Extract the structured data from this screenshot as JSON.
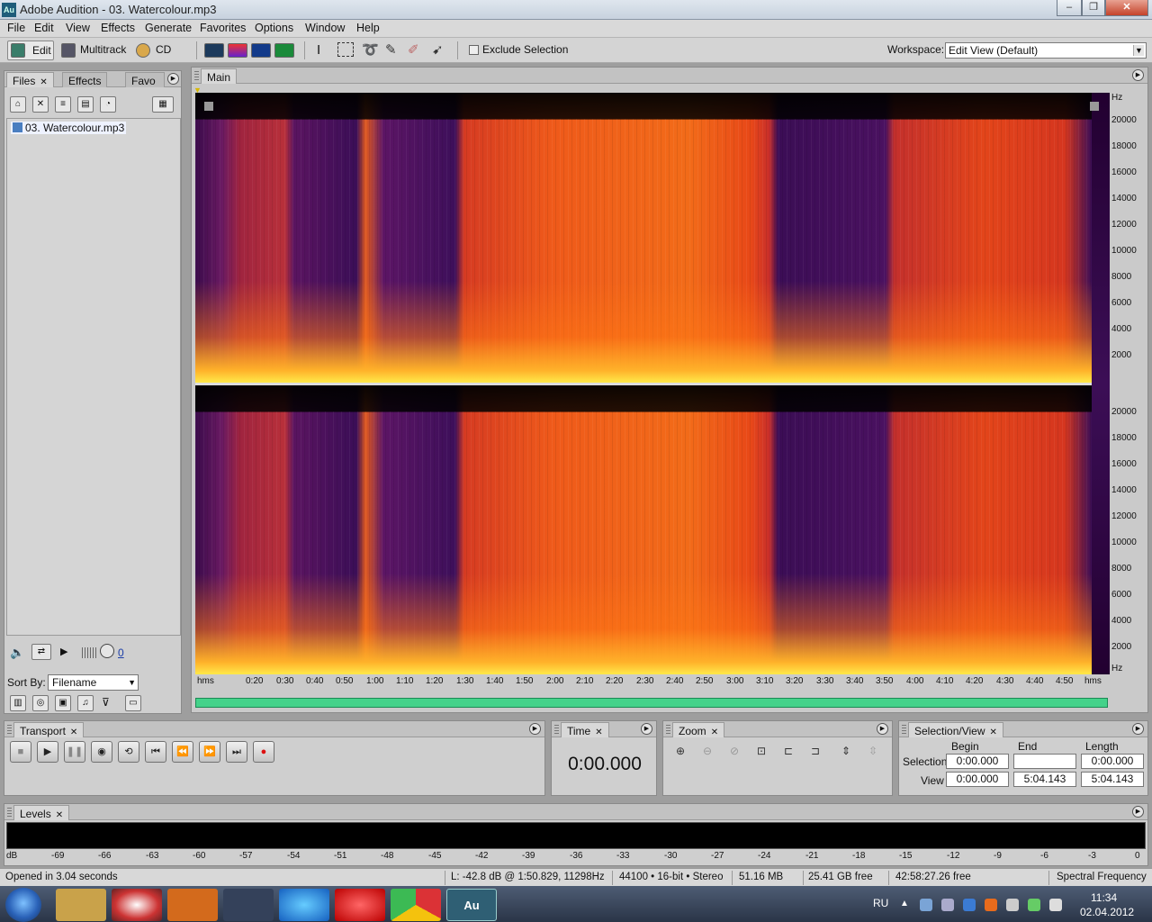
{
  "window": {
    "title": "Adobe Audition - 03. Watercolour.mp3",
    "app_icon": "Au",
    "min": "–",
    "max": "❐",
    "close": "✕"
  },
  "menu": [
    "File",
    "Edit",
    "View",
    "Effects",
    "Generate",
    "Favorites",
    "Options",
    "Window",
    "Help"
  ],
  "toolbar": {
    "edit_label": "Edit",
    "multitrack_label": "Multitrack",
    "cd_label": "CD",
    "exclude_selection": "Exclude Selection",
    "workspace_label": "Workspace:",
    "workspace_value": "Edit View (Default)"
  },
  "files_panel": {
    "tabs": [
      "Files",
      "Effects",
      "Favo"
    ],
    "file": "03. Watercolour.mp3",
    "sort_by_label": "Sort By:",
    "sort_by_value": "Filename",
    "volume_value": "0"
  },
  "main": {
    "tab": "Main",
    "hz_unit": "Hz",
    "hz_ticks_top": [
      "20000",
      "18000",
      "16000",
      "14000",
      "12000",
      "10000",
      "8000",
      "6000",
      "4000",
      "2000"
    ],
    "hz_ticks_bottom": [
      "20000",
      "18000",
      "16000",
      "14000",
      "12000",
      "10000",
      "8000",
      "6000",
      "4000",
      "2000",
      "Hz"
    ],
    "time_ticks": [
      "hms",
      "0:20",
      "0:30",
      "0:40",
      "0:50",
      "1:00",
      "1:10",
      "1:20",
      "1:30",
      "1:40",
      "1:50",
      "2:00",
      "2:10",
      "2:20",
      "2:30",
      "2:40",
      "2:50",
      "3:00",
      "3:10",
      "3:20",
      "3:30",
      "3:40",
      "3:50",
      "4:00",
      "4:10",
      "4:20",
      "4:30",
      "4:40",
      "4:50",
      "hms"
    ]
  },
  "transport": {
    "title": "Transport"
  },
  "time": {
    "title": "Time",
    "value": "0:00.000"
  },
  "zoom": {
    "title": "Zoom"
  },
  "selection_view": {
    "title": "Selection/View",
    "headers": [
      "Begin",
      "End",
      "Length"
    ],
    "selection_label": "Selection",
    "view_label": "View",
    "selection": [
      "0:00.000",
      "",
      "0:00.000"
    ],
    "view": [
      "0:00.000",
      "5:04.143",
      "5:04.143"
    ]
  },
  "levels": {
    "title": "Levels",
    "scale": [
      "dB",
      "-69",
      "-66",
      "-63",
      "-60",
      "-57",
      "-54",
      "-51",
      "-48",
      "-45",
      "-42",
      "-39",
      "-36",
      "-33",
      "-30",
      "-27",
      "-24",
      "-21",
      "-18",
      "-15",
      "-12",
      "-9",
      "-6",
      "-3",
      "0"
    ]
  },
  "status": {
    "opened": "Opened in 3.04 seconds",
    "cursor": "L: -42.8 dB @ 1:50.829, 11298Hz",
    "format": "44100 • 16-bit • Stereo",
    "size": "51.16 MB",
    "free": "25.41 GB free",
    "time_free": "42:58:27.26 free",
    "view_mode": "Spectral Frequency"
  },
  "taskbar": {
    "active_app": "Au",
    "lang": "RU",
    "time": "11:34",
    "date": "02.04.2012"
  },
  "colors": {
    "spectrum_low": "#3a0b4b",
    "spectrum_mid": "#d63b22",
    "spectrum_high": "#ffe94a",
    "scroll": "#44d28a"
  }
}
